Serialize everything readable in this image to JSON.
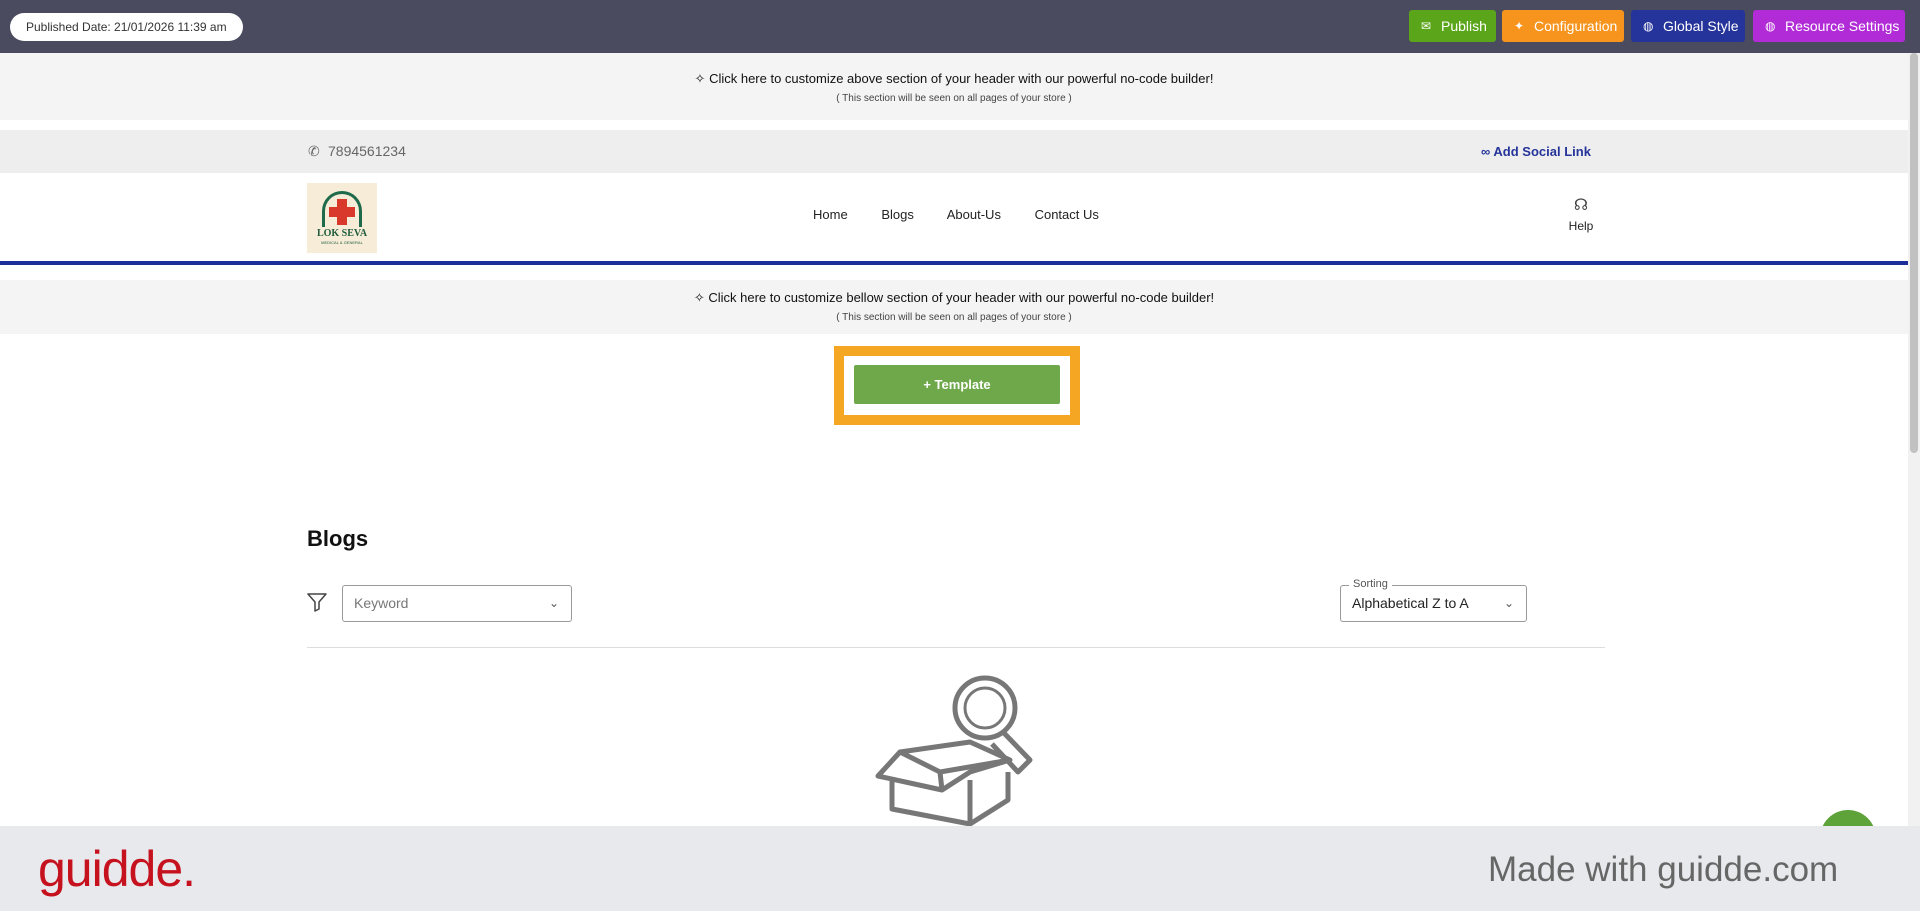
{
  "topbar": {
    "published": "Published Date: 21/01/2026 11:39 am",
    "buttons": [
      {
        "label": "Publish",
        "icon": "megaphone-icon",
        "color": "#5ba51a"
      },
      {
        "label": "Configuration",
        "icon": "sparkle-icon",
        "color": "#f7941d"
      },
      {
        "label": "Global Style",
        "icon": "globe-icon",
        "color": "#25349a"
      },
      {
        "label": "Resource Settings",
        "icon": "globe-icon",
        "color": "#b12bd6"
      }
    ]
  },
  "header_top": {
    "text": "Click here to customize above section of your header with our powerful no-code builder!",
    "note": "( This section will be seen on all pages of your store )"
  },
  "contact": {
    "phone": "7894561234",
    "social_link": "Add Social Link"
  },
  "nav": {
    "logo_text": "LOK SEVA",
    "logo_sub": "MEDICAL & GENERAL",
    "links": [
      "Home",
      "Blogs",
      "About-Us",
      "Contact Us"
    ],
    "help": "Help"
  },
  "header_bottom": {
    "text": "Click here to customize bellow section of your header with our powerful no-code builder!",
    "note": "( This section will be seen on all pages of your store )"
  },
  "template_button": "+ Template",
  "blogs": {
    "title": "Blogs",
    "keyword_placeholder": "Keyword",
    "sorting_label": "Sorting",
    "sorting_value": "Alphabetical Z to A"
  },
  "footer": {
    "brand": "guidde.",
    "made_with": "Made with guidde.com"
  },
  "colors": {
    "topbar": "#4a4b5f",
    "accent_blue": "#1c2e9a",
    "highlight": "#f5a623",
    "template_green": "#6ea84a"
  }
}
